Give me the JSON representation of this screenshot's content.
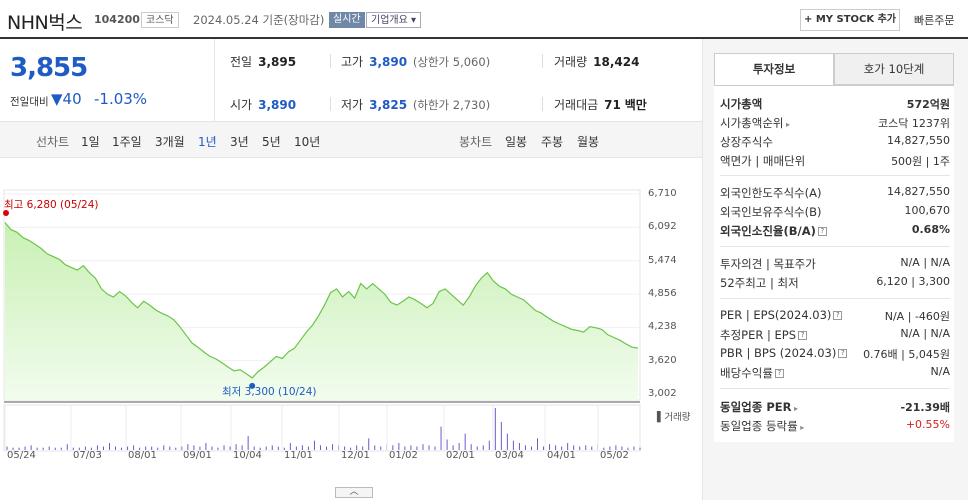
{
  "header": {
    "name": "NHN벅스",
    "code": "104200",
    "market": "코스닥",
    "date": "2024.05.24 기준(장마감)",
    "realtime": "실시간",
    "company_info": "기업개요",
    "mystock": "+ MY STOCK 추가",
    "quick_order": "빠른주문"
  },
  "price": {
    "current": "3,855",
    "compare_label": "전일대비",
    "change": "▼40",
    "change_pct": "-1.03%"
  },
  "summary": {
    "prev_label": "전일",
    "prev": "3,895",
    "high_label": "고가",
    "high": "3,890",
    "upper_limit": "(상한가 5,060)",
    "volume_label": "거래량",
    "volume": "18,424",
    "open_label": "시가",
    "open": "3,890",
    "low_label": "저가",
    "low": "3,825",
    "lower_limit": "(하한가 2,730)",
    "amount_label": "거래대금",
    "amount": "71",
    "amount_unit": "백만"
  },
  "periods": {
    "line_label": "선차트",
    "items": [
      "1일",
      "1주일",
      "3개월",
      "1년",
      "3년",
      "5년",
      "10년"
    ],
    "active": "1년",
    "candle_label": "봉차트",
    "candle_items": [
      "일봉",
      "주봉",
      "월봉"
    ]
  },
  "chart_data": {
    "type": "area",
    "yticks": [
      "6,710",
      "6,092",
      "5,474",
      "4,856",
      "4,238",
      "3,620",
      "3,002"
    ],
    "ylim": [
      3002,
      6710
    ],
    "xticks": [
      "05/24",
      "07/03",
      "08/01",
      "09/01",
      "10/04",
      "11/01",
      "12/01",
      "01/02",
      "02/01",
      "03/04",
      "04/01",
      "05/02"
    ],
    "high_label": "최고 6,280 (05/24)",
    "low_label": "최저 3,300 (10/24)",
    "volume_label": "거래량",
    "values": [
      6180,
      6050,
      6000,
      5900,
      5850,
      5780,
      5700,
      5600,
      5550,
      5500,
      5400,
      5350,
      5300,
      5380,
      5250,
      5150,
      4950,
      4850,
      4800,
      4900,
      4820,
      4700,
      4600,
      4720,
      4650,
      4560,
      4500,
      4450,
      4380,
      4250,
      4100,
      3950,
      3870,
      3780,
      3700,
      3650,
      3580,
      3500,
      3430,
      3450,
      3380,
      3300,
      3420,
      3500,
      3600,
      3700,
      3660,
      3780,
      3850,
      4000,
      4150,
      4280,
      4450,
      4650,
      4880,
      4950,
      4800,
      4900,
      4780,
      5050,
      4950,
      5050,
      4950,
      4850,
      4700,
      4650,
      4720,
      4800,
      4750,
      4680,
      4600,
      4680,
      4900,
      4950,
      4850,
      4750,
      4650,
      4800,
      5000,
      5150,
      5250,
      5100,
      5000,
      4950,
      4850,
      4800,
      4750,
      4650,
      4550,
      4500,
      4420,
      4350,
      4300,
      4250,
      4200,
      4180,
      4150,
      4250,
      4230,
      4200,
      4100,
      4050,
      4000,
      3930,
      3870,
      3855
    ],
    "volumes": [
      3,
      2,
      2,
      3,
      4,
      2,
      2,
      3,
      2,
      2,
      5,
      2,
      2,
      3,
      2,
      4,
      3,
      6,
      3,
      2,
      3,
      4,
      2,
      3,
      3,
      2,
      4,
      3,
      2,
      3,
      5,
      4,
      3,
      6,
      3,
      2,
      4,
      3,
      5,
      4,
      12,
      3,
      2,
      3,
      4,
      3,
      2,
      6,
      3,
      4,
      3,
      8,
      4,
      3,
      5,
      4,
      3,
      2,
      4,
      3,
      10,
      4,
      3,
      5,
      4,
      6,
      3,
      4,
      3,
      5,
      4,
      3,
      20,
      9,
      4,
      6,
      14,
      5,
      3,
      4,
      8,
      36,
      24,
      14,
      8,
      6,
      4,
      3,
      10,
      3,
      5,
      4,
      3,
      6,
      4,
      3,
      4,
      3,
      5,
      2,
      3,
      4,
      3,
      2,
      3,
      2
    ]
  },
  "side": {
    "tab_info": "투자정보",
    "tab_quote": "호가 10단계",
    "rows": [
      {
        "k": "시가총액",
        "v": "572억원",
        "bold": true
      },
      {
        "k": "시가총액순위",
        "v": "코스닥 1237위",
        "arrow": true
      },
      {
        "k": "상장주식수",
        "v": "14,827,550"
      },
      {
        "k": "액면가 | 매매단위",
        "v": "500원 | 1주"
      },
      {
        "k": "외국인한도주식수(A)",
        "v": "14,827,550"
      },
      {
        "k": "외국인보유주식수(B)",
        "v": "100,670"
      },
      {
        "k": "외국인소진율(B/A)",
        "v": "0.68%",
        "bold": true,
        "q": true
      },
      {
        "k": "투자의견 | 목표주가",
        "v": "N/A | N/A"
      },
      {
        "k": "52주최고 | 최저",
        "v": "6,120 | 3,300"
      },
      {
        "k": "PER | EPS(2024.03)",
        "v": "N/A | -460원",
        "q": true
      },
      {
        "k": "추정PER | EPS",
        "v": "N/A | N/A",
        "q": true
      },
      {
        "k": "PBR | BPS (2024.03)",
        "v": "0.76배 | 5,045원",
        "q": true
      },
      {
        "k": "배당수익률",
        "v": "N/A",
        "q": true
      },
      {
        "k": "동일업종 PER",
        "v": "-21.39배",
        "bold": true,
        "arrow": true
      },
      {
        "k": "동일업종 등락률",
        "v": "+0.55%",
        "arrow": true,
        "red": true
      }
    ]
  }
}
